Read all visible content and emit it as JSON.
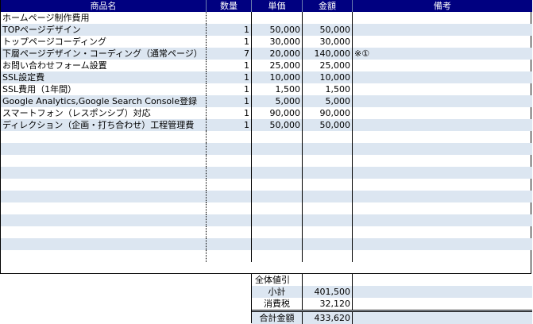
{
  "headers": [
    "商品名",
    "数量",
    "単価",
    "金額",
    "備考"
  ],
  "rows": [
    {
      "name": "ホームページ制作費用",
      "qty": "",
      "unit": "",
      "amount": "",
      "note": ""
    },
    {
      "name": "TOPページデザイン",
      "qty": "1",
      "unit": "50,000",
      "amount": "50,000",
      "note": ""
    },
    {
      "name": "トップページコーディング",
      "qty": "1",
      "unit": "30,000",
      "amount": "30,000",
      "note": ""
    },
    {
      "name": "下層ページデザイン・コーディング（通常ページ）",
      "qty": "7",
      "unit": "20,000",
      "amount": "140,000",
      "note": "※①"
    },
    {
      "name": "お問い合わせフォーム設置",
      "qty": "1",
      "unit": "25,000",
      "amount": "25,000",
      "note": ""
    },
    {
      "name": "SSL設定費",
      "qty": "1",
      "unit": "10,000",
      "amount": "10,000",
      "note": ""
    },
    {
      "name": "SSL費用（1年間）",
      "qty": "1",
      "unit": "1,500",
      "amount": "1,500",
      "note": ""
    },
    {
      "name": "Google Analytics,Google Search Console登録",
      "qty": "1",
      "unit": "5,000",
      "amount": "5,000",
      "note": ""
    },
    {
      "name": "スマートフォン（レスポンシブ）対応",
      "qty": "1",
      "unit": "90,000",
      "amount": "90,000",
      "note": ""
    },
    {
      "name": "ディレクション（企画・打ち合わせ）工程管理費",
      "qty": "1",
      "unit": "50,000",
      "amount": "50,000",
      "note": ""
    },
    {
      "name": "",
      "qty": "",
      "unit": "",
      "amount": "",
      "note": ""
    },
    {
      "name": "",
      "qty": "",
      "unit": "",
      "amount": "",
      "note": ""
    },
    {
      "name": "",
      "qty": "",
      "unit": "",
      "amount": "",
      "note": ""
    },
    {
      "name": "",
      "qty": "",
      "unit": "",
      "amount": "",
      "note": ""
    },
    {
      "name": "",
      "qty": "",
      "unit": "",
      "amount": "",
      "note": ""
    },
    {
      "name": "",
      "qty": "",
      "unit": "",
      "amount": "",
      "note": ""
    },
    {
      "name": "",
      "qty": "",
      "unit": "",
      "amount": "",
      "note": ""
    },
    {
      "name": "",
      "qty": "",
      "unit": "",
      "amount": "",
      "note": ""
    },
    {
      "name": "",
      "qty": "",
      "unit": "",
      "amount": "",
      "note": ""
    },
    {
      "name": "",
      "qty": "",
      "unit": "",
      "amount": "",
      "note": ""
    },
    {
      "name": "",
      "qty": "",
      "unit": "",
      "amount": "",
      "note": ""
    }
  ],
  "summary": {
    "discount_label": "全体値引",
    "subtotal_label": "小計",
    "subtotal_value": "401,500",
    "tax_label": "消費税",
    "tax_value": "32,120",
    "total_label": "合計金額",
    "total_value": "433,620"
  },
  "colors": {
    "header_bg": "#000080",
    "stripe": "#dce6f1"
  }
}
